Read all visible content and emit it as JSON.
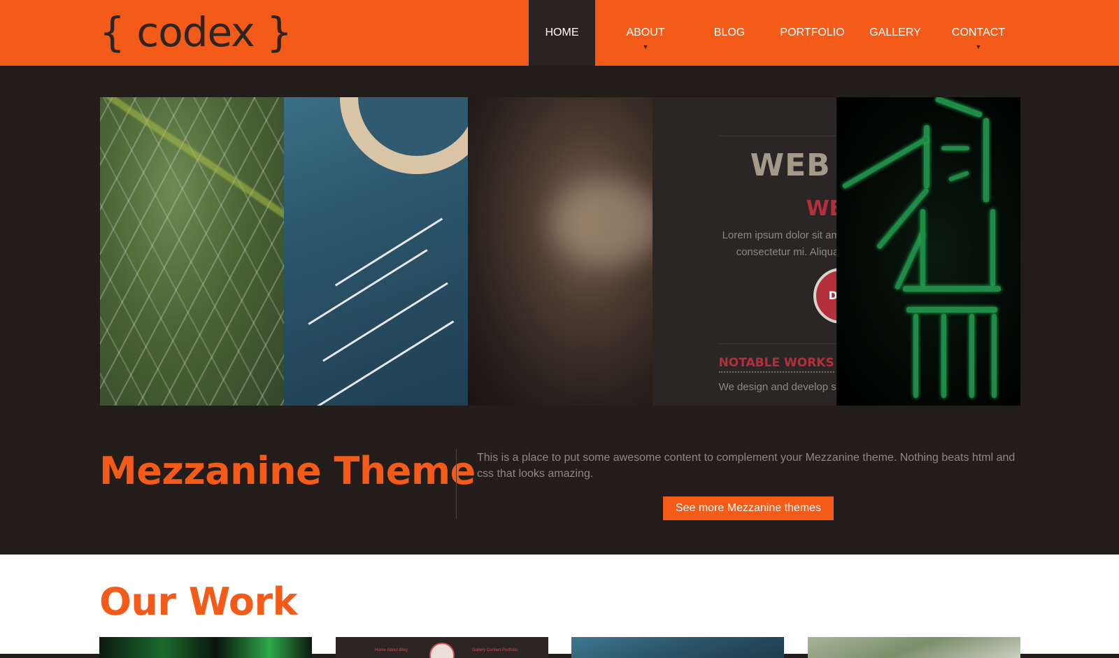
{
  "header": {
    "logo": "{ codex }",
    "nav": [
      {
        "label": "HOME",
        "active": true,
        "has_submenu": false
      },
      {
        "label": "ABOUT",
        "active": false,
        "has_submenu": true
      },
      {
        "label": "BLOG",
        "active": false,
        "has_submenu": false
      },
      {
        "label": "PORTFOLIO",
        "active": false,
        "has_submenu": false
      },
      {
        "label": "GALLERY",
        "active": false,
        "has_submenu": false
      },
      {
        "label": "CONTACT",
        "active": false,
        "has_submenu": true
      }
    ],
    "submenu_icon": "chevron-down-icon"
  },
  "slider": {
    "panels": [
      {
        "name": "abstract-green-smoke"
      },
      {
        "name": "dj-mixer-turntable"
      },
      {
        "name": "blurred-warm-photo"
      },
      {
        "name": "web-design-screenshot",
        "title": "WEB D",
        "subtitle": "WEI",
        "text_line1": "Lorem ipsum dolor sit amet,",
        "text_line2": "consectetur mi. Aliquam i",
        "badge_text": "D",
        "notable_heading": "NOTABLE WORKS",
        "notable_text": "We design and develop some"
      },
      {
        "name": "green-glowing-figure"
      }
    ]
  },
  "intro": {
    "title_first": "M",
    "title_rest": "ezzanine Theme",
    "text": "This is a place to put some awesome content to complement your Mezzanine theme. Nothing beats html and css that looks amazing.",
    "cta_label": "See more Mezzanine themes"
  },
  "work": {
    "title": "Our Work",
    "mini_nav_left": "Home   About   Blog",
    "mini_nav_right": "Gallery   Contact   Portfolio"
  },
  "colors": {
    "accent": "#f45b18",
    "dark": "#231d1b",
    "nav_active": "#2a2321"
  }
}
